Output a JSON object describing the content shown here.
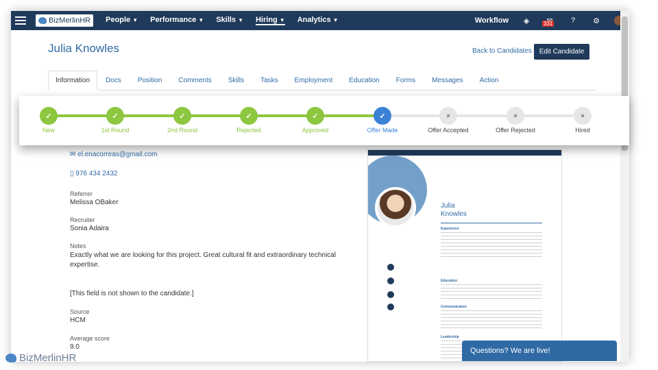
{
  "navbar": {
    "logo_text": "BizMerlinHR",
    "menu": [
      {
        "label": "People"
      },
      {
        "label": "Performance"
      },
      {
        "label": "Skills"
      },
      {
        "label": "Hiring"
      },
      {
        "label": "Analytics"
      }
    ],
    "workflow_label": "Workflow",
    "mail_badge": "331"
  },
  "candidate": {
    "name": "Julia Knowles",
    "back_label": "Back to Candidates",
    "edit_label": "Edit Candidate"
  },
  "tabs": [
    "Information",
    "Docs",
    "Position",
    "Comments",
    "Skills",
    "Tasks",
    "Employment",
    "Education",
    "Forms",
    "Messages",
    "Action"
  ],
  "pipeline": {
    "stages": [
      {
        "label": "New",
        "state": "done"
      },
      {
        "label": "1st Round",
        "state": "done"
      },
      {
        "label": "2nd Round",
        "state": "done"
      },
      {
        "label": "Rejected",
        "state": "done"
      },
      {
        "label": "Approved",
        "state": "done"
      },
      {
        "label": "Offer Made",
        "state": "current"
      },
      {
        "label": "Offer Accepted",
        "state": "todo"
      },
      {
        "label": "Offer Rejected",
        "state": "todo"
      },
      {
        "label": "Hired",
        "state": "todo"
      }
    ],
    "done_mark": "✓",
    "todo_mark": "×"
  },
  "details": {
    "email": "el.enacorreas@gmail.com",
    "phone": "976 434 2432",
    "referrer_label": "Referrer",
    "referrer": "Melissa OBaker",
    "recruiter_label": "Recruiter",
    "recruiter": "Sonia Adaira",
    "notes_label": "Notes",
    "notes": "Exactly what we are looking for this project. Great cultural fit and extraordinary technical expertise.",
    "hidden_note": "[This field is not shown to the candidate.]",
    "source_label": "Source",
    "source": "HCM",
    "score_label": "Average score",
    "score": "9.0"
  },
  "resume": {
    "first_name": "Julia",
    "last_name": "Knowles",
    "sections": [
      "Experience",
      "Education",
      "Communication",
      "Leadership"
    ]
  },
  "chat_label": "Questions? We are live!",
  "watermark_text": "BizMerlinHR",
  "colors": {
    "navy": "#1f3a5a",
    "accent": "#2f6aa5",
    "done": "#8dc63f",
    "current": "#3b82d6"
  }
}
